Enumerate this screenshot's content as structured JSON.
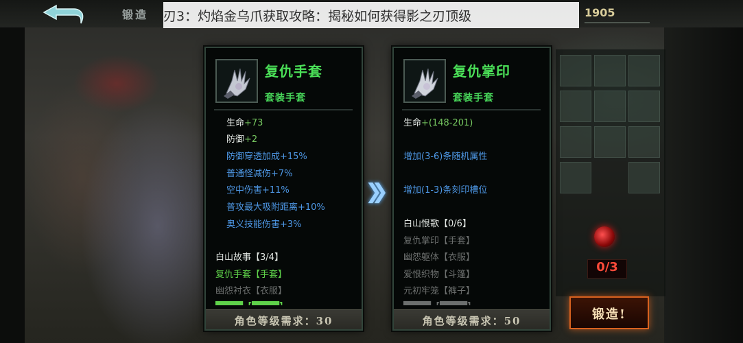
{
  "header": {
    "back_icon": "back-arrow-icon",
    "title": "锻造",
    "banner": "刃3：灼焰金乌爪获取攻略：揭秘如何获得影之刃顶级",
    "gold": "1905"
  },
  "left_item": {
    "name": "复仇手套",
    "subtitle": "套装手套",
    "icon": "claw-glove-icon",
    "stats": [
      {
        "label": "生命",
        "value": "+73"
      },
      {
        "label": "防御",
        "value": "+2"
      },
      {
        "text": "防御穿透加成+15%"
      },
      {
        "text": "普通怪减伤+7%"
      },
      {
        "text": "空中伤害+11%"
      },
      {
        "text": "普攻最大吸附距离+10%"
      },
      {
        "text": "奥义技能伤害+3%"
      }
    ],
    "set": {
      "name": "白山故事",
      "progress": "【3/4】",
      "pieces": [
        {
          "name": "复仇手套",
          "slot": "【手套】"
        },
        {
          "name": "幽怨衬衣",
          "slot": "【衣服】"
        },
        {
          "name": "████",
          "slot": "【████】"
        }
      ]
    },
    "requirement": "角色等级需求：30"
  },
  "right_item": {
    "name": "复仇掌印",
    "subtitle": "套装手套",
    "icon": "claw-glove-icon",
    "stats": [
      {
        "label": "生命",
        "value": "+(148-201)"
      },
      {
        "text": "增加(3-6)条随机属性"
      },
      {
        "text": "增加(1-3)条刻印槽位"
      }
    ],
    "set": {
      "name": "白山恨歌",
      "progress": "【0/6】",
      "pieces": [
        {
          "name": "复仇掌印",
          "slot": "【手套】"
        },
        {
          "name": "幽怨躯体",
          "slot": "【衣服】"
        },
        {
          "name": "爱恨织物",
          "slot": "【斗篷】"
        },
        {
          "name": "元初牢笼",
          "slot": "【裤子】"
        },
        {
          "name": "████",
          "slot": "【████】"
        }
      ]
    },
    "requirement": "角色等级需求：50"
  },
  "arrow_icon": "double-chevron-right-icon",
  "materials": {
    "orb_icon": "blood-orb-icon",
    "count": "0/3"
  },
  "forge_button": "锻造!"
}
